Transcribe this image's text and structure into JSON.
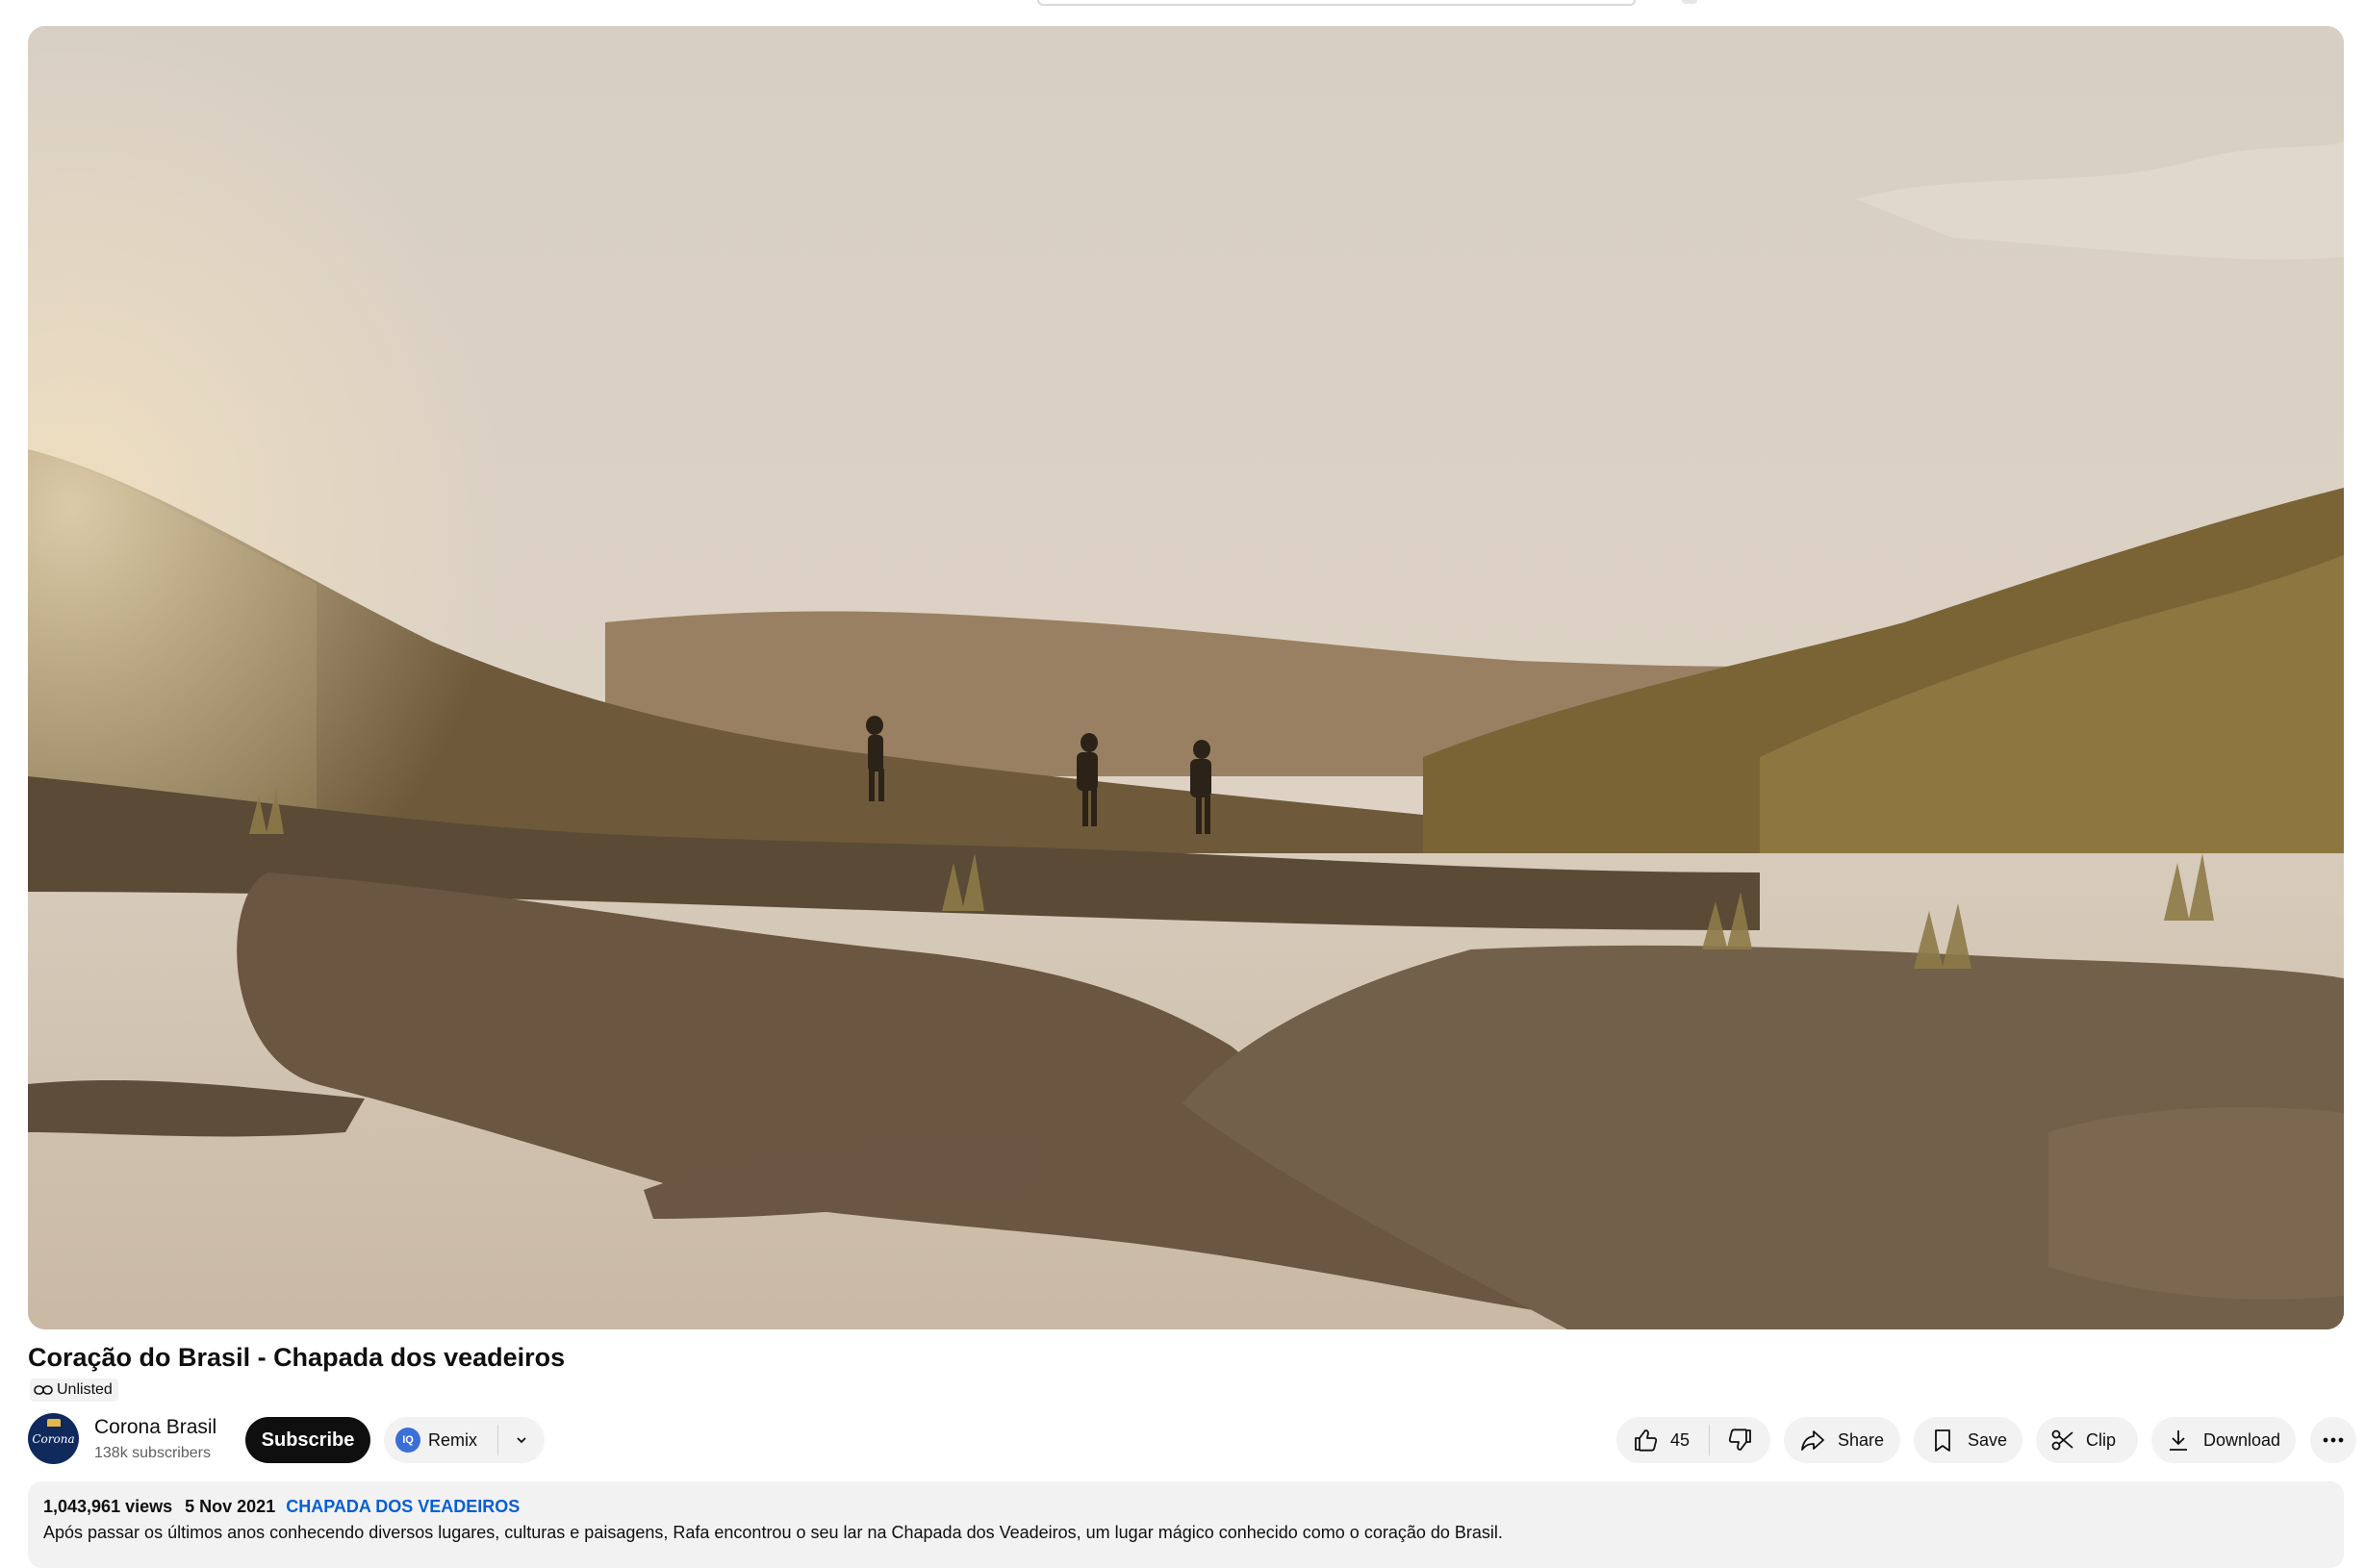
{
  "video": {
    "title": "Coração do Brasil - Chapada dos veadeiros",
    "visibility": "Unlisted"
  },
  "channel": {
    "name": "Corona Brasil",
    "subscribers": "138k subscribers",
    "avatar_text": "Corona"
  },
  "actions": {
    "subscribe": "Subscribe",
    "remix": "Remix",
    "remix_icon_text": "IQ",
    "likes": "45",
    "share": "Share",
    "save": "Save",
    "clip": "Clip",
    "download": "Download"
  },
  "description": {
    "views": "1,043,961 views",
    "date": "5 Nov 2021",
    "hashtag": "CHAPADA DOS VEADEIROS",
    "text": "Após passar os últimos anos conhecendo diversos lugares, culturas e paisagens, Rafa encontrou o seu lar na Chapada dos Veadeiros, um lugar mágico conhecido como o coração do Brasil."
  },
  "icons": {
    "like": "thumbs-up-icon",
    "dislike": "thumbs-down-icon",
    "share": "share-arrow-icon",
    "save": "bookmark-icon",
    "clip": "scissors-icon",
    "download": "download-icon",
    "more": "more-horizontal-icon",
    "unlisted": "link-icon",
    "remix_chevron": "chevron-down-icon"
  },
  "colors": {
    "subscribe_bg": "#0f0f0f",
    "pill_bg": "#f2f2f2",
    "hashtag": "#065fd4",
    "avatar_bg": "#102a5e"
  }
}
